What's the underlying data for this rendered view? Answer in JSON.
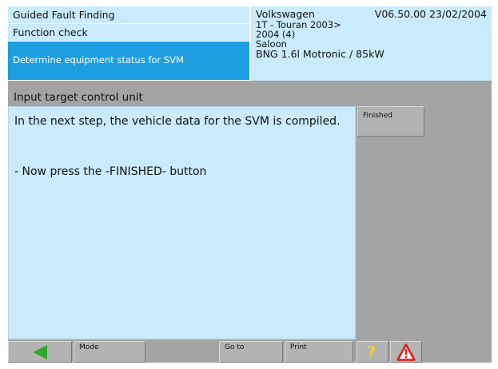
{
  "header": {
    "breadcrumb": [
      "Guided Fault Finding",
      "Function check",
      "Determine equipment status for SVM"
    ],
    "vehicle": {
      "make": "Volkswagen",
      "version": "V06.50.00 23/02/2004",
      "model": "1T - Touran 2003>",
      "year": "2004 (4)",
      "body": "Saloon",
      "engine": "BNG 1.6l Motronic / 85kW"
    }
  },
  "main": {
    "title": "Input target control unit",
    "text_line1": "In the next step, the vehicle data for the SVM is compiled.",
    "text_line2": "- Now press the -FINISHED- button"
  },
  "side": {
    "finished_label": "Finished"
  },
  "toolbar": {
    "mode_label": "Mode",
    "goto_label": "Go to",
    "print_label": "Print",
    "help_glyph": "?"
  },
  "colors": {
    "panel": "#c9ebfb",
    "selected": "#1c9ee0",
    "back_arrow": "#2ea82e",
    "help": "#f2d21a",
    "warning": "#e01818"
  },
  "icons": [
    "back-arrow-icon",
    "help-icon",
    "warning-icon"
  ]
}
